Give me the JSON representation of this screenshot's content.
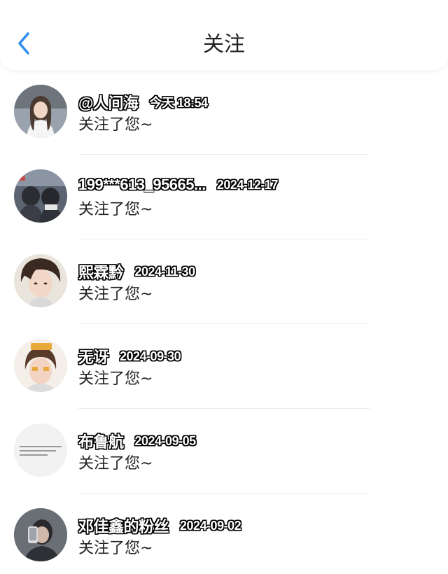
{
  "header": {
    "title": "关注",
    "back_icon": "chevron-left-icon",
    "accent_color": "#2f8ff0"
  },
  "follows": [
    {
      "nickname": "@人间海",
      "time": "今天 18:54",
      "message": "关注了您~"
    },
    {
      "nickname": "199***613_95665...",
      "time": "2024-12-17",
      "message": "关注了您~"
    },
    {
      "nickname": "熙霖黔",
      "time": "2024-11-30",
      "message": "关注了您~"
    },
    {
      "nickname": "无讶",
      "time": "2024-09-30",
      "message": "关注了您~"
    },
    {
      "nickname": "布鲁航",
      "time": "2024-09-05",
      "message": "关注了您~"
    },
    {
      "nickname": "邓佳鑫的粉丝",
      "time": "2024-09-02",
      "message": "关注了您~"
    }
  ]
}
